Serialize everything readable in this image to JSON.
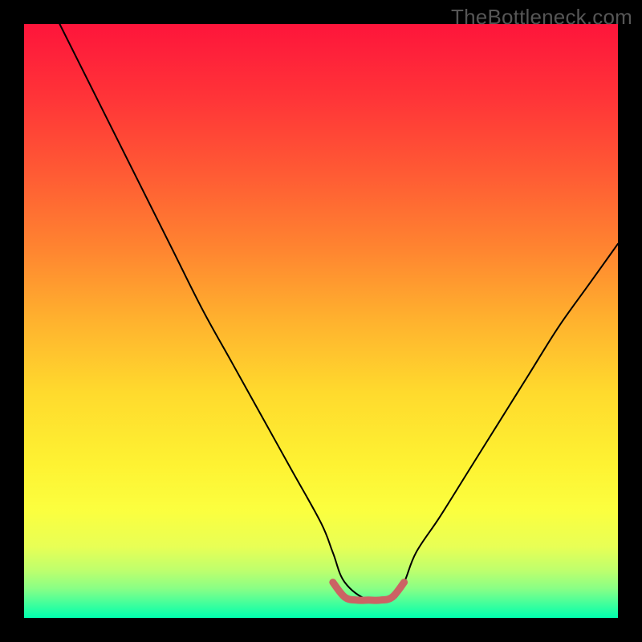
{
  "watermark": "TheBottleneck.com",
  "colors": {
    "bg": "#000000",
    "curve": "#000000",
    "flat_line": "#cb6364",
    "watermark": "#565656",
    "gradient_stops": [
      {
        "offset": 0.0,
        "color": "#fe153b"
      },
      {
        "offset": 0.12,
        "color": "#ff3338"
      },
      {
        "offset": 0.25,
        "color": "#ff5a34"
      },
      {
        "offset": 0.38,
        "color": "#ff8530"
      },
      {
        "offset": 0.5,
        "color": "#ffb22e"
      },
      {
        "offset": 0.62,
        "color": "#ffda2d"
      },
      {
        "offset": 0.74,
        "color": "#fef232"
      },
      {
        "offset": 0.82,
        "color": "#fbff3f"
      },
      {
        "offset": 0.88,
        "color": "#e8ff55"
      },
      {
        "offset": 0.92,
        "color": "#beff6d"
      },
      {
        "offset": 0.95,
        "color": "#8aff85"
      },
      {
        "offset": 0.975,
        "color": "#44ff9b"
      },
      {
        "offset": 1.0,
        "color": "#00ffae"
      }
    ]
  },
  "chart_data": {
    "type": "line",
    "title": "",
    "xlabel": "",
    "ylabel": "",
    "xlim": [
      0,
      100
    ],
    "ylim": [
      0,
      100
    ],
    "grid": false,
    "legend": false,
    "series": [
      {
        "name": "bottleneck_curve",
        "x": [
          6,
          10,
          15,
          20,
          25,
          30,
          35,
          40,
          45,
          50,
          52,
          54,
          58,
          62,
          64,
          66,
          70,
          75,
          80,
          85,
          90,
          95,
          100
        ],
        "y": [
          100,
          92,
          82,
          72,
          62,
          52,
          43,
          34,
          25,
          16,
          11,
          6,
          3,
          3,
          6,
          11,
          17,
          25,
          33,
          41,
          49,
          56,
          63
        ]
      },
      {
        "name": "optimal_flat_segment",
        "x": [
          52,
          54,
          56,
          58,
          60,
          62,
          64
        ],
        "y": [
          6,
          3.5,
          3,
          3,
          3,
          3.5,
          6
        ]
      }
    ]
  }
}
